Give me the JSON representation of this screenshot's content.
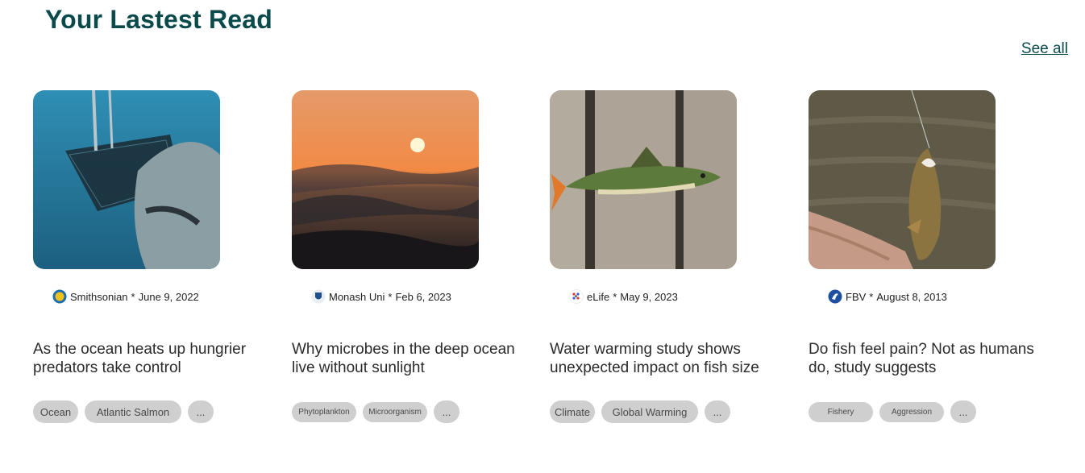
{
  "page": {
    "title": "Your Lastest Read",
    "see_all": "See all"
  },
  "colors": {
    "heading": "#0b4a4b",
    "tag_bg": "#cfcfcf",
    "text": "#2b2b2b"
  },
  "articles": [
    {
      "source": "Smithsonian",
      "separator": "*",
      "date": "June 9, 2022",
      "headline": "As the ocean heats up hungrier predators take control",
      "image": "shark-and-net-underwater",
      "logo_icon": "sun-logo-icon",
      "tags": [
        "Ocean",
        "Atlantic Salmon",
        "..."
      ]
    },
    {
      "source": "Monash Uni",
      "separator": "*",
      "date": "Feb 6, 2023",
      "headline": "Why microbes in the deep ocean live without sunlight",
      "image": "sunset-over-ocean-waves",
      "logo_icon": "shield-logo-icon",
      "tags": [
        "Phytoplankton",
        "Microorganism",
        "..."
      ]
    },
    {
      "source": "eLife",
      "separator": "*",
      "date": "May 9, 2023",
      "headline": "Water warming study shows unexpected impact on fish size",
      "image": "perch-on-wooden-dock",
      "logo_icon": "dots-logo-icon",
      "tags": [
        "Climate",
        "Global Warming",
        "..."
      ]
    },
    {
      "source": "FBV",
      "separator": "*",
      "date": "August 8, 2013",
      "headline": "Do fish feel pain? Not as humans do, study suggests",
      "image": "fish-on-hook-over-water",
      "logo_icon": "fbv-logo-icon",
      "tags": [
        "Fishery",
        "Aggression",
        "..."
      ]
    }
  ]
}
